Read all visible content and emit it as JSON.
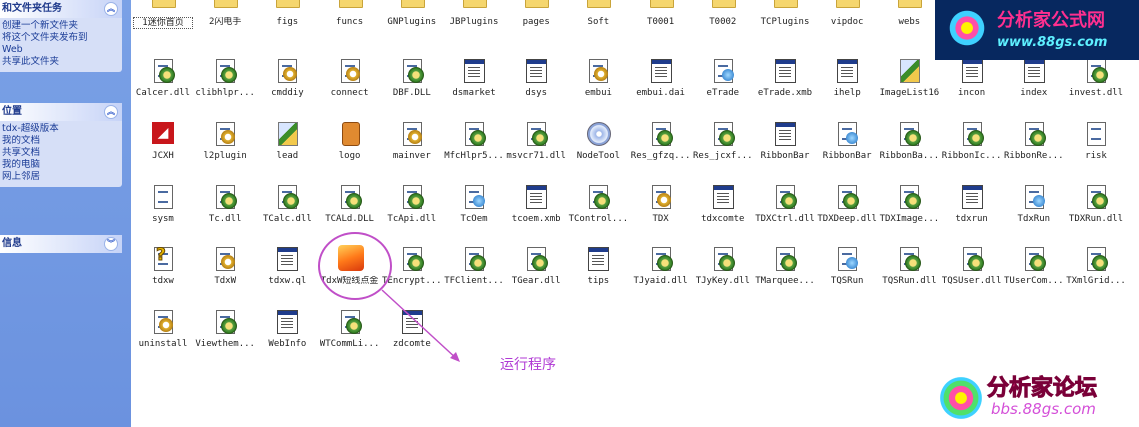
{
  "sidebar": {
    "panels": [
      {
        "title": "和文件夹任务",
        "items": [
          "创建一个新文件夹",
          "将这个文件夹发布到",
          "Web",
          "共享此文件夹"
        ]
      },
      {
        "title": "位置",
        "items": [
          "tdx-超级版本",
          "我的文档",
          "共享文档",
          "我的电脑",
          "网上邻居"
        ]
      },
      {
        "title": "信息",
        "items": []
      }
    ],
    "collapse_glyph": "︽",
    "expand_glyph": "︾"
  },
  "files": [
    {
      "name": "1迷你首页",
      "icon": "folder-icon",
      "selected": true
    },
    {
      "name": "2闪电手",
      "icon": "folder-icon"
    },
    {
      "name": "figs",
      "icon": "folder-icon"
    },
    {
      "name": "funcs",
      "icon": "folder-icon"
    },
    {
      "name": "GNPlugins",
      "icon": "folder-icon"
    },
    {
      "name": "JBPlugins",
      "icon": "folder-icon"
    },
    {
      "name": "pages",
      "icon": "folder-icon"
    },
    {
      "name": "Soft",
      "icon": "folder-icon"
    },
    {
      "name": "T0001",
      "icon": "folder-icon"
    },
    {
      "name": "T0002",
      "icon": "folder-icon"
    },
    {
      "name": "TCPlugins",
      "icon": "folder-icon"
    },
    {
      "name": "vipdoc",
      "icon": "folder-icon"
    },
    {
      "name": "webs",
      "icon": "folder-icon"
    },
    {
      "name": "Calcer.dll",
      "icon": "dll-icon"
    },
    {
      "name": "clibhlpr...",
      "icon": "dll-icon"
    },
    {
      "name": "cmddiy",
      "icon": "settings-file-icon"
    },
    {
      "name": "connect",
      "icon": "settings-file-icon"
    },
    {
      "name": "DBF.DLL",
      "icon": "dll-icon"
    },
    {
      "name": "dsmarket",
      "icon": "data-file-icon"
    },
    {
      "name": "dsys",
      "icon": "window-file-icon"
    },
    {
      "name": "embui",
      "icon": "settings-file-icon"
    },
    {
      "name": "embui.dai",
      "icon": "data-file-icon"
    },
    {
      "name": "eTrade",
      "icon": "web-file-icon"
    },
    {
      "name": "eTrade.xmb",
      "icon": "data-file-icon"
    },
    {
      "name": "ihelp",
      "icon": "window-file-icon"
    },
    {
      "name": "ImageList16",
      "icon": "brush-icon"
    },
    {
      "name": "incon",
      "icon": "data-file-icon"
    },
    {
      "name": "index",
      "icon": "data-file-icon"
    },
    {
      "name": "invest.dll",
      "icon": "dll-icon"
    },
    {
      "name": "JCXH",
      "icon": "red-app-icon"
    },
    {
      "name": "l2plugin",
      "icon": "settings-file-icon"
    },
    {
      "name": "lead",
      "icon": "brush-icon"
    },
    {
      "name": "logo",
      "icon": "jar-icon"
    },
    {
      "name": "mainver",
      "icon": "settings-file-icon"
    },
    {
      "name": "MfcHlpr5...",
      "icon": "dll-icon"
    },
    {
      "name": "msvcr71.dll",
      "icon": "dll-icon"
    },
    {
      "name": "NodeTool",
      "icon": "disc-icon"
    },
    {
      "name": "Res_gfzq...",
      "icon": "dll-icon"
    },
    {
      "name": "Res_jcxf...",
      "icon": "dll-icon"
    },
    {
      "name": "RibbonBar",
      "icon": "window-file-icon"
    },
    {
      "name": "RibbonBar",
      "icon": "web-file-icon"
    },
    {
      "name": "RibbonBa...",
      "icon": "dll-icon"
    },
    {
      "name": "RibbonIc...",
      "icon": "dll-icon"
    },
    {
      "name": "RibbonRe...",
      "icon": "dll-icon"
    },
    {
      "name": "risk",
      "icon": "text-file-icon"
    },
    {
      "name": "sysm",
      "icon": "text-file-icon"
    },
    {
      "name": "Tc.dll",
      "icon": "dll-icon"
    },
    {
      "name": "TCalc.dll",
      "icon": "dll-icon"
    },
    {
      "name": "TCALd.DLL",
      "icon": "dll-icon"
    },
    {
      "name": "TcApi.dll",
      "icon": "dll-icon"
    },
    {
      "name": "TcOem",
      "icon": "web-file-icon"
    },
    {
      "name": "tcoem.xmb",
      "icon": "data-file-icon"
    },
    {
      "name": "TControl...",
      "icon": "dll-icon"
    },
    {
      "name": "TDX",
      "icon": "settings-file-icon"
    },
    {
      "name": "tdxcomte",
      "icon": "window-file-icon"
    },
    {
      "name": "TDXCtrl.dll",
      "icon": "dll-icon"
    },
    {
      "name": "TDXDeep.dll",
      "icon": "dll-icon"
    },
    {
      "name": "TDXImage...",
      "icon": "dll-icon"
    },
    {
      "name": "tdxrun",
      "icon": "window-file-icon"
    },
    {
      "name": "TdxRun",
      "icon": "web-file-icon"
    },
    {
      "name": "TDXRun.dll",
      "icon": "dll-icon"
    },
    {
      "name": "tdxw",
      "icon": "help-icon"
    },
    {
      "name": "TdxW",
      "icon": "settings-file-icon"
    },
    {
      "name": "tdxw.ql",
      "icon": "window-file-icon"
    },
    {
      "name": "TdxW短线点金",
      "icon": "flame-app-icon"
    },
    {
      "name": "TEncrypt...",
      "icon": "dll-icon"
    },
    {
      "name": "TFClient...",
      "icon": "dll-icon"
    },
    {
      "name": "TGear.dll",
      "icon": "dll-icon"
    },
    {
      "name": "tips",
      "icon": "data-file-icon"
    },
    {
      "name": "TJyaid.dll",
      "icon": "dll-icon"
    },
    {
      "name": "TJyKey.dll",
      "icon": "dll-icon"
    },
    {
      "name": "TMarquee...",
      "icon": "dll-icon"
    },
    {
      "name": "TQSRun",
      "icon": "web-file-icon"
    },
    {
      "name": "TQSRun.dll",
      "icon": "dll-icon"
    },
    {
      "name": "TQSUser.dll",
      "icon": "dll-icon"
    },
    {
      "name": "TUserCom...",
      "icon": "dll-icon"
    },
    {
      "name": "TXmlGrid...",
      "icon": "dll-icon"
    },
    {
      "name": "uninstall",
      "icon": "settings-file-icon"
    },
    {
      "name": "Viewthem...",
      "icon": "dll-icon"
    },
    {
      "name": "WebInfo",
      "icon": "window-file-icon"
    },
    {
      "name": "WTCommLi...",
      "icon": "dll-icon"
    },
    {
      "name": "zdcomte",
      "icon": "window-file-icon"
    }
  ],
  "annotation": {
    "label": "运行程序",
    "color": "#b03ad4"
  },
  "watermark_top": {
    "title": "分析家公式网",
    "url": "www.88gs.com"
  },
  "watermark_bottom": {
    "title": "分析家论坛",
    "url": "bbs.88gs.com"
  }
}
